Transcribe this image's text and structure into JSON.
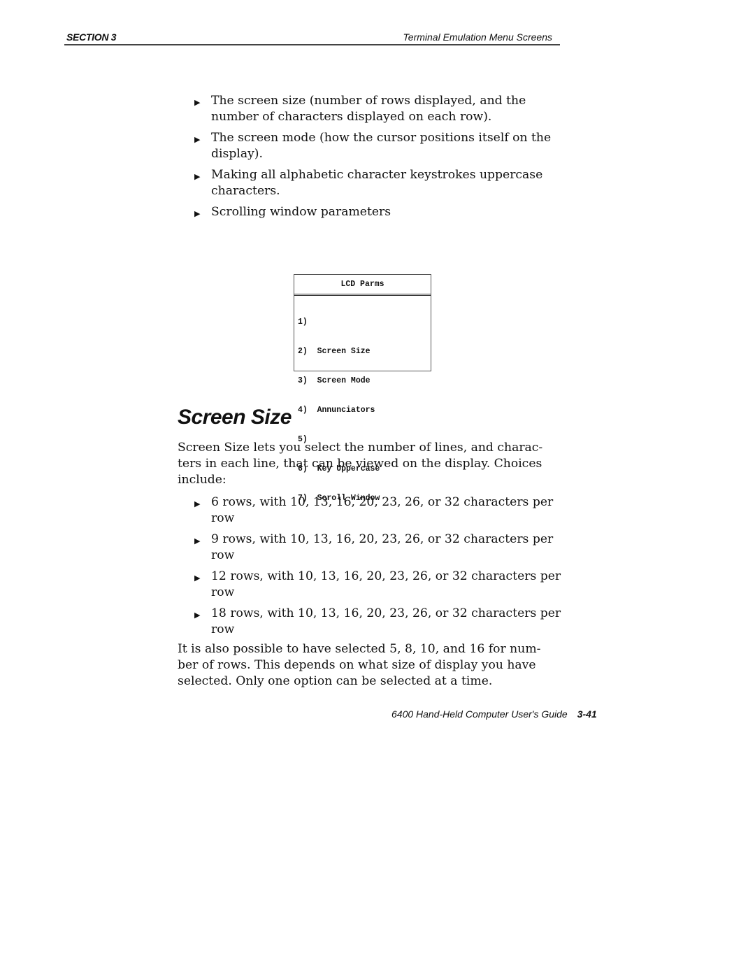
{
  "header": {
    "section": "SECTION 3",
    "title": "Terminal Emulation Menu Screens"
  },
  "intro_bullets": [
    "The screen size (number of rows displayed, and the number of characters displayed on each row).",
    "The screen mode (how the cursor positions itself on the display).",
    "Making all alphabetic character keystrokes uppercase characters.",
    "Scrolling window parameters"
  ],
  "lcd_menu": {
    "title": "LCD Parms",
    "items": [
      "1)",
      "2)  Screen Size",
      "3)  Screen Mode",
      "4)  Annunciators",
      "5)",
      "6)  Key Uppercase",
      "7)  Scroll Window"
    ]
  },
  "section_heading": "Screen Size",
  "intro_paragraph": "Screen Size lets you select the number of lines, and charac-ters in each line, that can be viewed on the display. Choices include:",
  "choices": [
    "6 rows, with 10, 13, 16, 20, 23, 26, or 32 characters per row",
    "9 rows, with 10, 13, 16, 20, 23, 26, or 32 characters per row",
    "12 rows, with 10, 13, 16, 20, 23, 26, or 32 characters per row",
    "18 rows, with 10, 13, 16, 20, 23, 26, or 32 characters per row"
  ],
  "closing_paragraph": "It is also possible to have selected 5, 8, 10, and 16 for num-ber of rows. This depends on what size of display you have selected. Only one option can be selected at a time.",
  "footer": {
    "guide_title": "6400 Hand-Held Computer User's Guide",
    "page_number": "3-41"
  },
  "icons": {
    "bullet": "right-pointing-triangle"
  }
}
